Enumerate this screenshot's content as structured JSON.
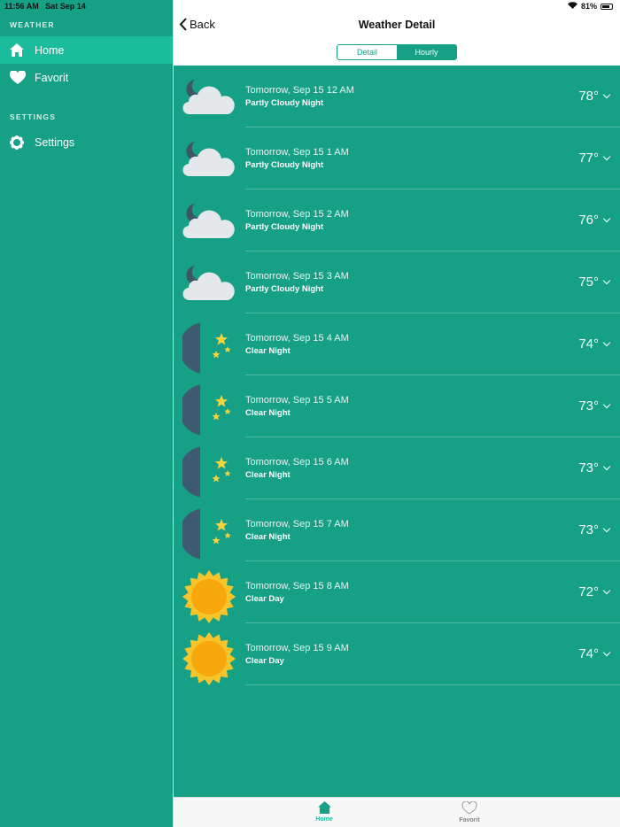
{
  "status_bar": {
    "time": "11:56 AM",
    "date": "Sat Sep 14",
    "battery": "81%",
    "battery_level": 0.81
  },
  "sidebar": {
    "sections": [
      {
        "title": "WEATHER",
        "items": [
          {
            "label": "Home",
            "icon": "home-icon",
            "selected": true
          },
          {
            "label": "Favorit",
            "icon": "heart-icon"
          }
        ]
      },
      {
        "title": "SETTINGS",
        "items": [
          {
            "label": "Settings",
            "icon": "gear-icon"
          }
        ]
      }
    ]
  },
  "nav": {
    "back_label": "Back",
    "title": "Weather Detail"
  },
  "segments": {
    "detail": "Detail",
    "hourly": "Hourly",
    "selected": "Hourly"
  },
  "hourly": [
    {
      "time": "Tomorrow, Sep 15 12 AM",
      "summary": "Partly Cloudy Night",
      "temp": "78°",
      "icon": "partly-cloudy-night"
    },
    {
      "time": "Tomorrow, Sep 15 1 AM",
      "summary": "Partly Cloudy Night",
      "temp": "77°",
      "icon": "partly-cloudy-night"
    },
    {
      "time": "Tomorrow, Sep 15 2 AM",
      "summary": "Partly Cloudy Night",
      "temp": "76°",
      "icon": "partly-cloudy-night"
    },
    {
      "time": "Tomorrow, Sep 15 3 AM",
      "summary": "Partly Cloudy Night",
      "temp": "75°",
      "icon": "partly-cloudy-night"
    },
    {
      "time": "Tomorrow, Sep 15 4 AM",
      "summary": "Clear Night",
      "temp": "74°",
      "icon": "clear-night"
    },
    {
      "time": "Tomorrow, Sep 15 5 AM",
      "summary": "Clear Night",
      "temp": "73°",
      "icon": "clear-night"
    },
    {
      "time": "Tomorrow, Sep 15 6 AM",
      "summary": "Clear Night",
      "temp": "73°",
      "icon": "clear-night"
    },
    {
      "time": "Tomorrow, Sep 15 7 AM",
      "summary": "Clear Night",
      "temp": "73°",
      "icon": "clear-night"
    },
    {
      "time": "Tomorrow, Sep 15 8 AM",
      "summary": "Clear Day",
      "temp": "72°",
      "icon": "clear-day"
    },
    {
      "time": "Tomorrow, Sep 15 9 AM",
      "summary": "Clear Day",
      "temp": "74°",
      "icon": "clear-day"
    }
  ],
  "tabbar": {
    "home": "Home",
    "favorit": "Favorit"
  },
  "colors": {
    "accent": "#16a085",
    "selected": "#1abc9c"
  }
}
